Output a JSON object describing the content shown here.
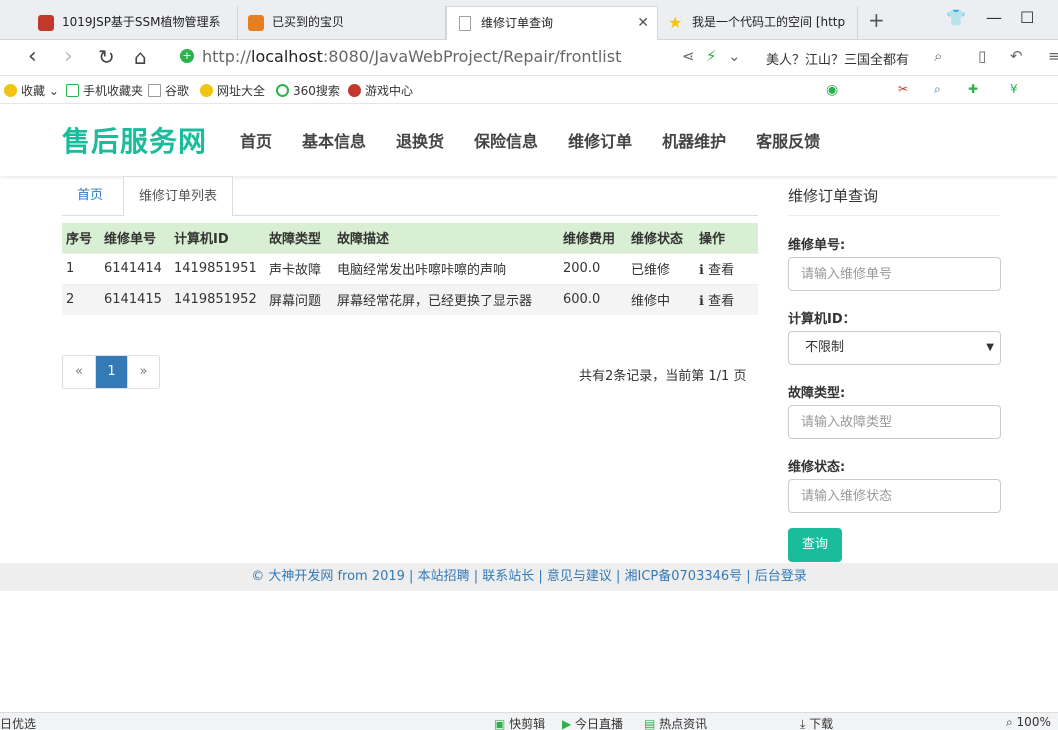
{
  "browser": {
    "tabs": [
      {
        "title": "1019JSP基于SSM植物管理系",
        "icon_color": "#c0392b"
      },
      {
        "title": "已买到的宝贝",
        "icon_color": "#e67e22"
      },
      {
        "title": "维修订单查询",
        "icon_color": "#9aa0a6"
      },
      {
        "title": "我是一个代码工的空间 [http",
        "icon_color": "#f1c40f"
      }
    ],
    "new_tab": "+",
    "url_prefix": "http://",
    "url_host": "localhost",
    "url_rest": ":8080/JavaWebProject/Repair/frontlist",
    "news_text": "美人？江山？三国全都有",
    "bookmarks": [
      "收藏",
      "手机收藏夹",
      "谷歌",
      "网址大全",
      "360搜索",
      "游戏中心"
    ]
  },
  "site": {
    "logo": "售后服务网",
    "nav": [
      "首页",
      "基本信息",
      "退换货",
      "保险信息",
      "维修订单",
      "机器维护",
      "客服反馈"
    ],
    "accent": "#1abc9c"
  },
  "content": {
    "tabs": [
      "首页",
      "维修订单列表"
    ],
    "columns": [
      "序号",
      "维修单号",
      "计算机ID",
      "故障类型",
      "故障描述",
      "维修费用",
      "维修状态",
      "操作"
    ],
    "rows": [
      {
        "no": "1",
        "order": "6141414",
        "pc": "1419851951",
        "type": "声卡故障",
        "desc": "电脑经常发出咔嚓咔嚓的声响",
        "fee": "200.0",
        "status": "已维修",
        "op": "ℹ 查看"
      },
      {
        "no": "2",
        "order": "6141415",
        "pc": "1419851952",
        "type": "屏幕问题",
        "desc": "屏幕经常花屏，已经更换了显示器",
        "fee": "600.0",
        "status": "维修中",
        "op": "ℹ 查看"
      }
    ],
    "pager": {
      "prev": "«",
      "current": "1",
      "next": "»"
    },
    "record_info": "共有2条记录，当前第 1/1 页"
  },
  "sidebar": {
    "title": "维修订单查询",
    "order_label": "维修单号:",
    "order_placeholder": "请输入维修单号",
    "pc_label": "计算机ID：",
    "pc_value": "不限制",
    "type_label": "故障类型:",
    "type_placeholder": "请输入故障类型",
    "status_label": "维修状态:",
    "status_placeholder": "请输入维修状态",
    "query_button": "查询"
  },
  "footer": {
    "text": "© 大神开发网 from 2019 | 本站招聘 | 联系站长 | 意见与建议 | 湘ICP备0703346号 | 后台登录"
  },
  "statusbar": {
    "left": "日优选",
    "items": [
      "快剪辑",
      "今日直播",
      "热点资讯",
      "下载",
      "100%"
    ]
  }
}
